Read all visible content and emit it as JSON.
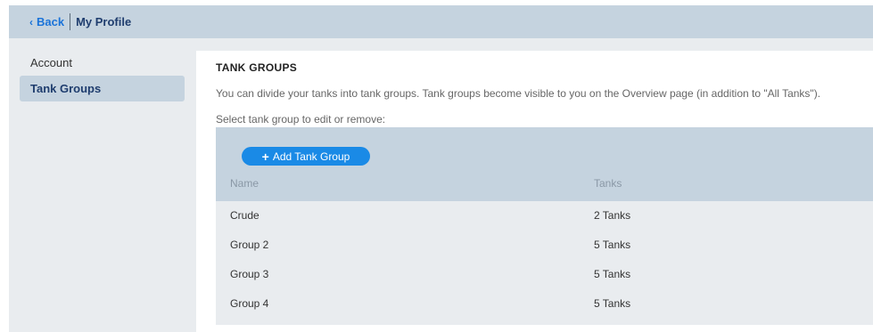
{
  "header": {
    "back_label": "Back",
    "title": "My Profile"
  },
  "sidebar": {
    "items": [
      {
        "label": "Account"
      },
      {
        "label": "Tank Groups",
        "active": true
      }
    ]
  },
  "main": {
    "section_title": "TANK GROUPS",
    "description": "You can divide your tanks into tank groups. Tank groups become visible to you on the Overview page (in addition to \"All Tanks\").",
    "select_prompt": "Select tank group to edit or remove:",
    "add_button_label": "Add Tank Group",
    "columns": [
      "Name",
      "Tanks"
    ],
    "rows": [
      {
        "name": "Crude",
        "tanks": "2 Tanks"
      },
      {
        "name": "Group 2",
        "tanks": "5 Tanks"
      },
      {
        "name": "Group 3",
        "tanks": "5 Tanks"
      },
      {
        "name": "Group 4",
        "tanks": "5 Tanks"
      }
    ]
  },
  "colors": {
    "accent": "#1a8ae6",
    "link": "#1a73d9",
    "header_bg": "#c5d3df",
    "panel_bg": "#e9ecef"
  }
}
